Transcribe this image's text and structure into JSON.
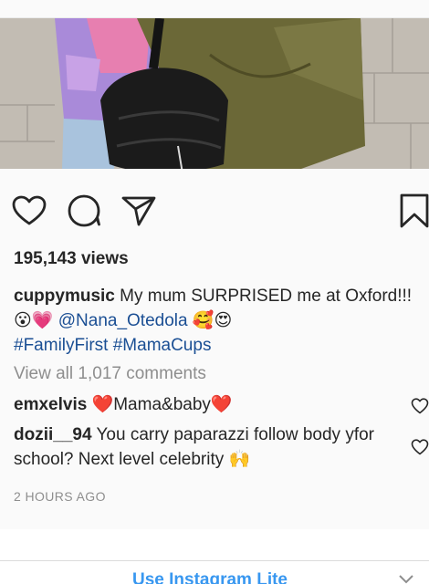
{
  "post": {
    "views": "195,143 views",
    "caption": {
      "username": "cuppymusic",
      "text_before": " My mum SURPRISED me at Oxford!!! 😮💗 ",
      "mention": "@Nana_Otedola",
      "text_after": " 🥰😍",
      "hashtag1": "#FamilyFirst",
      "hashtag2": "#MamaCups"
    },
    "view_all_comments": "View all 1,017 comments",
    "comments": [
      {
        "username": "emxelvis",
        "text": " ❤️Mama&baby❤️"
      },
      {
        "username": "dozii__94",
        "text": " You carry paparazzi follow body yfor school? Next level celebrity 🙌"
      }
    ],
    "timestamp": "2 HOURS AGO"
  },
  "icons": {
    "like": "heart-icon",
    "comment": "speech-bubble-icon",
    "share": "paper-plane-icon",
    "save": "bookmark-icon",
    "comment_like": "small-heart-icon",
    "banner_close": "chevron-down-icon"
  },
  "banner": {
    "label": "Use Instagram Lite"
  },
  "colors": {
    "link": "#1b4f94",
    "banner_link": "#3897f0",
    "muted": "#8e8e8e",
    "text": "#262626"
  }
}
